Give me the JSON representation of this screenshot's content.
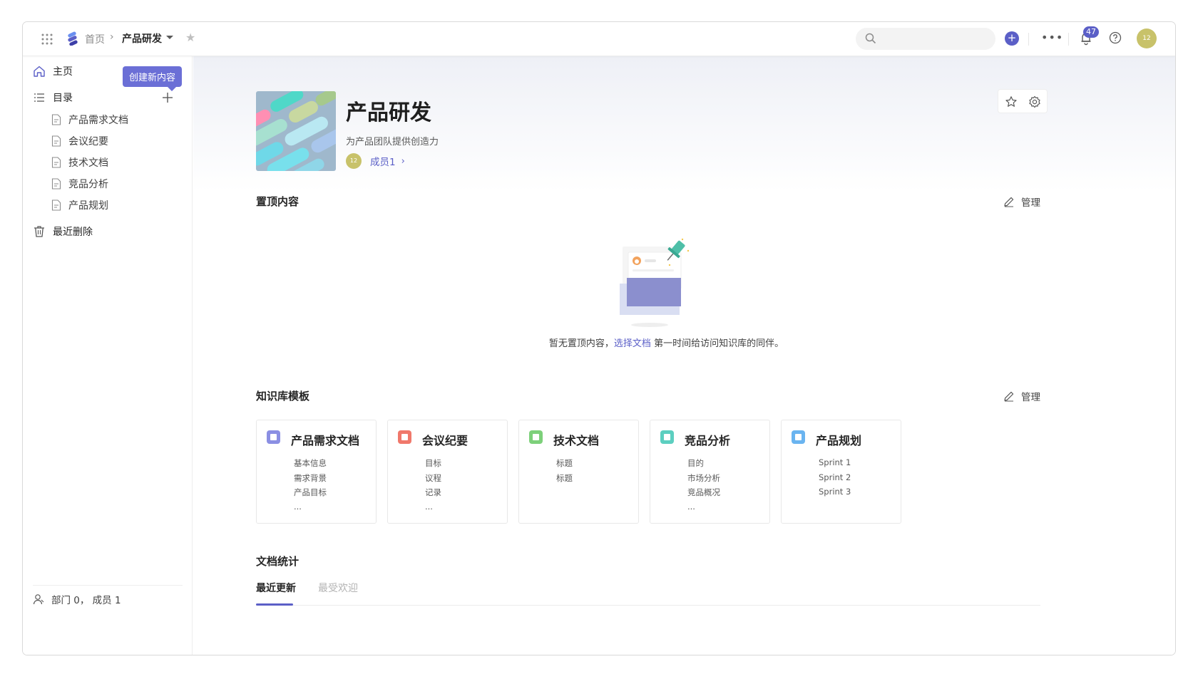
{
  "breadcrumb": {
    "home": "首页",
    "separator": "›",
    "current": "产品研发"
  },
  "topbar": {
    "notification_count": "47",
    "avatar_text": "12"
  },
  "sidebar": {
    "home_label": "主页",
    "tooltip": "创建新内容",
    "catalog_label": "目录",
    "docs": [
      "产品需求文档",
      "会议纪要",
      "技术文档",
      "竞品分析",
      "产品规划"
    ],
    "trash_label": "最近删除",
    "footer": "部门 0， 成员 1"
  },
  "space": {
    "title": "产品研发",
    "description": "为产品团队提供创造力",
    "member_avatar": "12",
    "member_link": "成员1",
    "member_chevron": "›"
  },
  "pinned": {
    "title": "置顶内容",
    "manage": "管理",
    "empty_prefix": "暂无置顶内容，",
    "empty_link": "选择文档",
    "empty_suffix": " 第一时间给访问知识库的同伴。"
  },
  "templates": {
    "title": "知识库模板",
    "manage": "管理",
    "cards": [
      {
        "title": "产品需求文档",
        "color": "#8b8fe3",
        "lines": [
          "基本信息",
          "需求背景",
          "产品目标",
          "..."
        ]
      },
      {
        "title": "会议纪要",
        "color": "#f0786b",
        "lines": [
          "目标",
          "议程",
          "记录",
          "..."
        ]
      },
      {
        "title": "技术文档",
        "color": "#7dd07a",
        "lines": [
          "标题",
          "标题"
        ]
      },
      {
        "title": "竞品分析",
        "color": "#5ccfc0",
        "lines": [
          "目的",
          "市场分析",
          "竞品概况",
          "..."
        ]
      },
      {
        "title": "产品规划",
        "color": "#6ab4f0",
        "lines": [
          "Sprint 1",
          "Sprint 2",
          "Sprint 3"
        ]
      }
    ]
  },
  "stats": {
    "title": "文档统计",
    "tabs": [
      "最近更新",
      "最受欢迎"
    ]
  }
}
